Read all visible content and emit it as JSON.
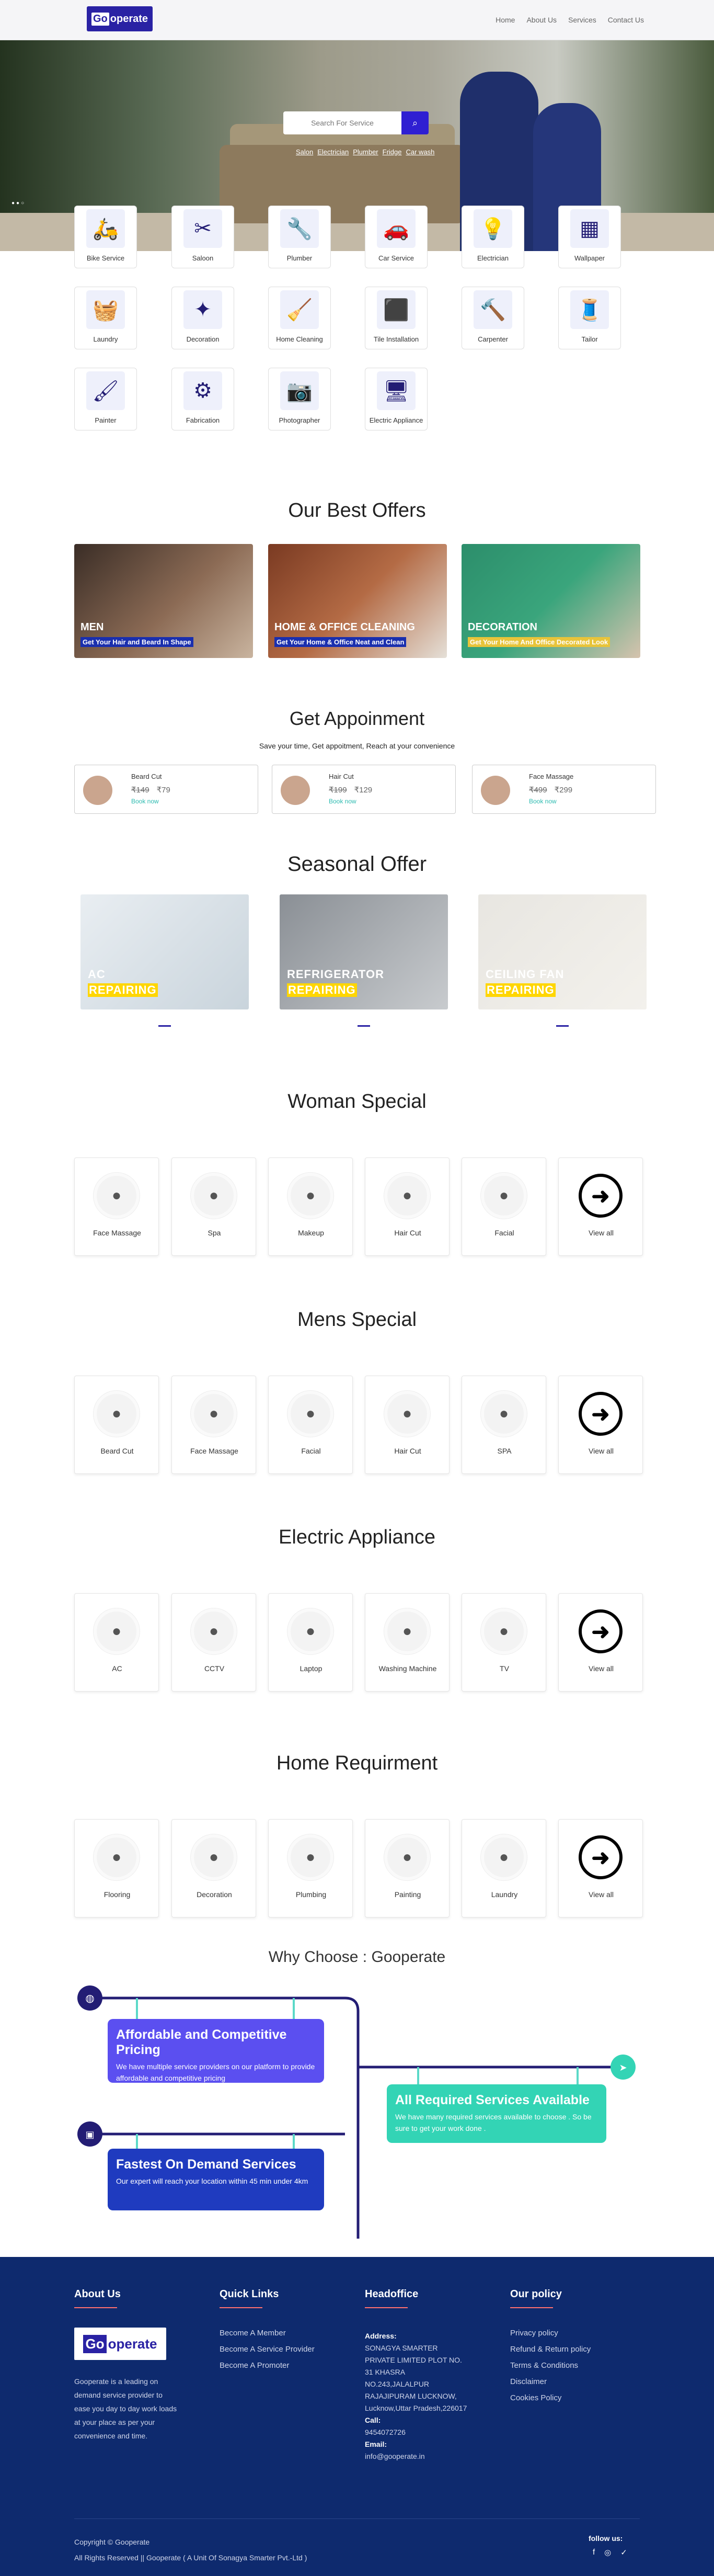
{
  "brand": {
    "logo_left": "Go",
    "logo_right": "operate"
  },
  "nav": {
    "items": [
      "Home",
      "About Us",
      "Services",
      "Contact Us"
    ]
  },
  "hero": {
    "search_placeholder": "Search For Service",
    "tags": [
      "Salon",
      "Electrician",
      "Plumber",
      "Fridge",
      "Car wash"
    ]
  },
  "services": [
    {
      "label": "Bike Service",
      "icon": "bike-service-icon",
      "glyph": "🛵"
    },
    {
      "label": "Saloon",
      "icon": "saloon-icon",
      "glyph": "✂"
    },
    {
      "label": "Plumber",
      "icon": "plumber-icon",
      "glyph": "🔧"
    },
    {
      "label": "Car Service",
      "icon": "car-service-icon",
      "glyph": "🚗"
    },
    {
      "label": "Electrician",
      "icon": "electrician-icon",
      "glyph": "💡"
    },
    {
      "label": "Wallpaper",
      "icon": "wallpaper-icon",
      "glyph": "▦"
    },
    {
      "label": "Laundry",
      "icon": "laundry-icon",
      "glyph": "🧺"
    },
    {
      "label": "Decoration",
      "icon": "decoration-icon",
      "glyph": "✦"
    },
    {
      "label": "Home Cleaning",
      "icon": "home-cleaning-icon",
      "glyph": "🧹"
    },
    {
      "label": "Tile Installation",
      "icon": "tile-installation-icon",
      "glyph": "⬛"
    },
    {
      "label": "Carpenter",
      "icon": "carpenter-icon",
      "glyph": "🔨"
    },
    {
      "label": "Tailor",
      "icon": "tailor-icon",
      "glyph": "🧵"
    },
    {
      "label": "Painter",
      "icon": "painter-icon",
      "glyph": "🖌"
    },
    {
      "label": "Fabrication",
      "icon": "fabrication-icon",
      "glyph": "⚙"
    },
    {
      "label": "Photographer",
      "icon": "photographer-icon",
      "glyph": "📷"
    },
    {
      "label": "Electric Appliance",
      "icon": "electric-appliance-icon",
      "glyph": "🖥"
    }
  ],
  "best_offers": {
    "title": "Our Best Offers",
    "items": [
      {
        "title": "MEN",
        "sub": "Get Your Hair and Beard In Shape"
      },
      {
        "title": "HOME & OFFICE CLEANING",
        "sub": "Get Your Home & Office Neat and Clean"
      },
      {
        "title": "DECORATION",
        "sub": "Get Your Home And Office Decorated Look"
      }
    ]
  },
  "appointment": {
    "title": "Get Appoinment",
    "subtitle": "Save your time, Get appoitment, Reach at your convenience",
    "items": [
      {
        "name": "Beard Cut",
        "old": "₹149",
        "new": "₹79",
        "cta": "Book now"
      },
      {
        "name": "Hair Cut",
        "old": "₹199",
        "new": "₹129",
        "cta": "Book now"
      },
      {
        "name": "Face Massage",
        "old": "₹499",
        "new": "₹299",
        "cta": "Book now"
      }
    ]
  },
  "seasonal": {
    "title": "Seasonal Offer",
    "items": [
      {
        "l1": "AC",
        "l2": "REPAIRING"
      },
      {
        "l1": "REFRIGERATOR",
        "l2": "REPAIRING"
      },
      {
        "l1": "CEILING FAN",
        "l2": "REPAIRING"
      }
    ]
  },
  "woman": {
    "title": "Woman Special",
    "items": [
      "Face Massage",
      "Spa",
      "Makeup",
      "Hair Cut",
      "Facial",
      "View all"
    ]
  },
  "mens": {
    "title": "Mens Special",
    "items": [
      "Beard Cut",
      "Face Massage",
      "Facial",
      "Hair Cut",
      "SPA",
      "View all"
    ]
  },
  "electric": {
    "title": "Electric Appliance",
    "items": [
      "AC",
      "CCTV",
      "Laptop",
      "Washing Machine",
      "TV",
      "View all"
    ]
  },
  "home": {
    "title": "Home Requirment",
    "items": [
      "Flooring",
      "Decoration",
      "Plumbing",
      "Painting",
      "Laundry",
      "View all"
    ]
  },
  "why": {
    "title": "Why Choose : Gooperate",
    "items": [
      {
        "title": "Affordable and Competitive Pricing",
        "desc": "We have multiple service providers on our platform to provide affordable and competitive pricing",
        "color": "#5b4ff0"
      },
      {
        "title": "All Required Services Available",
        "desc": "We have many required services available to choose . So be sure to get your work done .",
        "color": "#33d4b5"
      },
      {
        "title": "Fastest On Demand Services",
        "desc": "Our expert will reach your location within 45 min under 4km",
        "color": "#1f3bbf"
      }
    ]
  },
  "footer": {
    "about_h": "About Us",
    "about_text": "Gooperate is a leading on demand service provider to ease you day to day work loads at your place as per your convenience and time.",
    "links_h": "Quick Links",
    "links": [
      "Become A Member",
      "Become A Service Provider",
      "Become A Promoter"
    ],
    "office_h": "Headoffice",
    "address_label": "Address:",
    "address": "SONAGYA SMARTER PRIVATE LIMITED PLOT NO. 31 KHASRA NO.243,JALALPUR RAJAJIPURAM LUCKNOW, Lucknow,Uttar Pradesh,226017",
    "call_label": "Call:",
    "phone": "9454072726",
    "email_label": "Email:",
    "email": "info@gooperate.in",
    "policy_h": "Our policy",
    "policies": [
      "Privacy policy",
      "Refund & Return policy",
      "Terms & Conditions",
      "Disclaimer",
      "Cookies Policy"
    ],
    "copyright": "Copyright © Gooperate",
    "rights": "All Rights Reserved || Gooperate ( A Unit Of Sonagya Smarter Pvt.-Ltd )",
    "follow": "follow us:"
  }
}
